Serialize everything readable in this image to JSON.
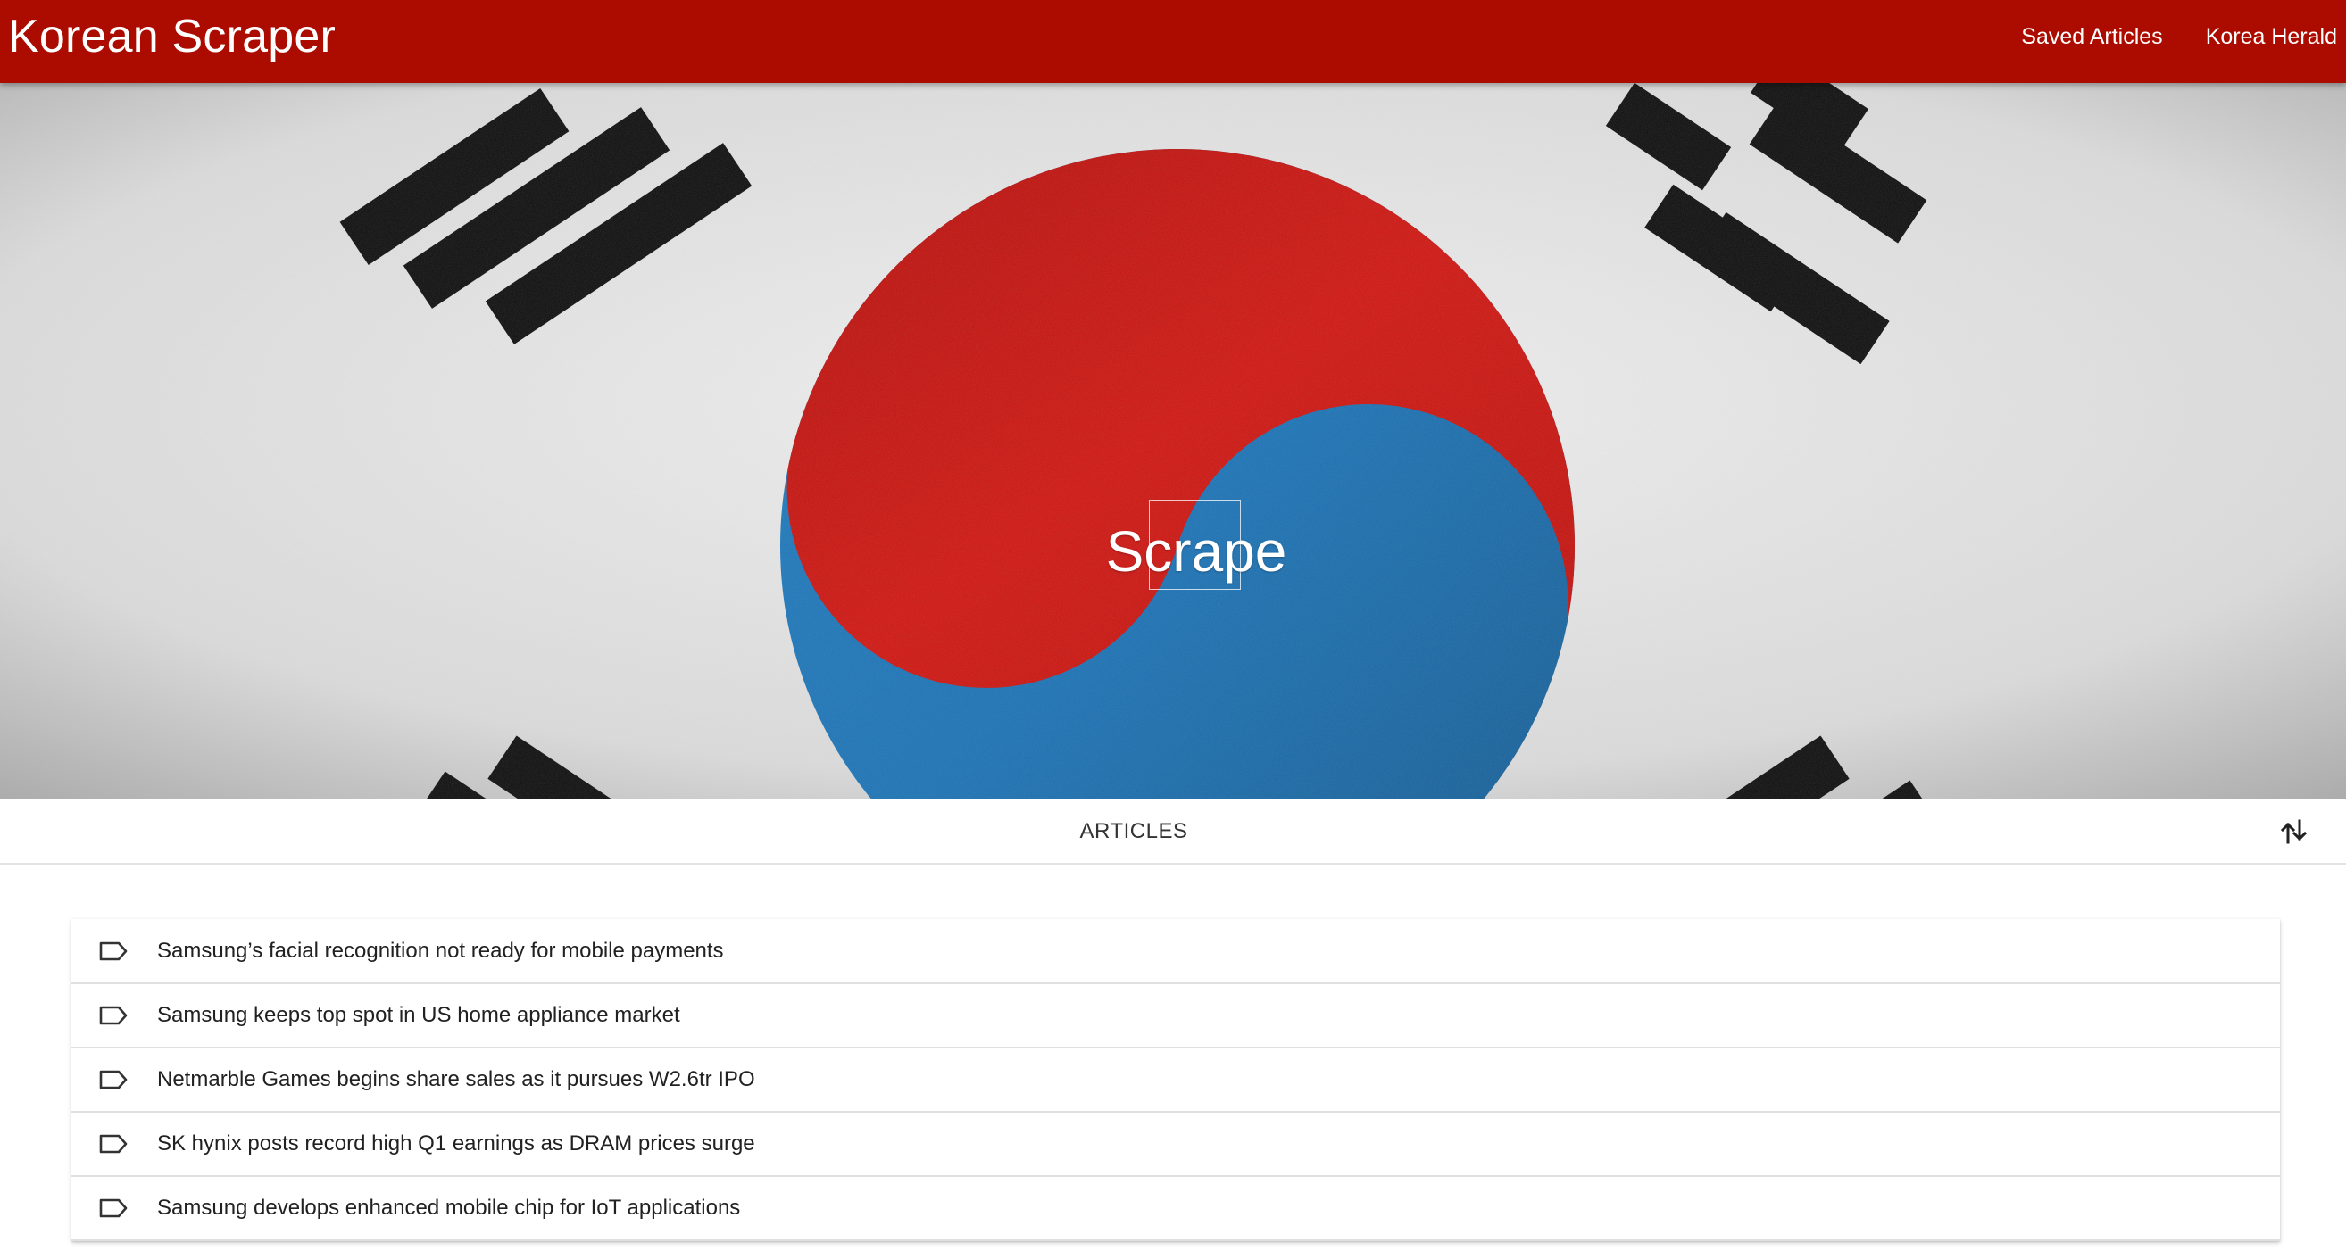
{
  "navbar": {
    "brand": "Korean Scraper",
    "links": [
      {
        "label": "Saved Articles"
      },
      {
        "label": "Korea Herald"
      }
    ]
  },
  "hero": {
    "button_label": "Scrape",
    "flag_colors": {
      "background": "#e6e6e6",
      "red": "#c8110c",
      "blue": "#1a6ba7",
      "bars": "#0d0d0d"
    }
  },
  "tabs": {
    "articles_label": "ARTICLES",
    "sort_icon": "swap-vertical-icon"
  },
  "articles": [
    {
      "title": "Samsung’s facial recognition not ready for mobile payments",
      "icon": "label-outline-icon"
    },
    {
      "title": "Samsung keeps top spot in US home appliance market",
      "icon": "label-outline-icon"
    },
    {
      "title": "Netmarble Games begins share sales as it pursues W2.6tr IPO",
      "icon": "label-outline-icon"
    },
    {
      "title": "SK hynix posts record high Q1 earnings as DRAM prices surge",
      "icon": "label-outline-icon"
    },
    {
      "title": "Samsung develops enhanced mobile chip for IoT applications",
      "icon": "label-outline-icon"
    }
  ]
}
